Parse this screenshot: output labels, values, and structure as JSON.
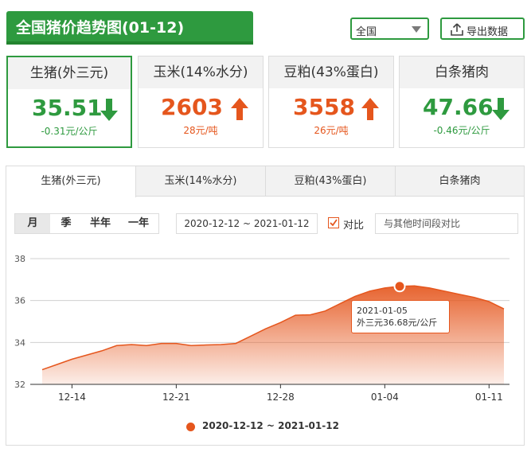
{
  "header": {
    "title": "全国猪价趋势图(01-12)",
    "region": "全国",
    "export_label": "导出数据"
  },
  "cards": [
    {
      "name": "生猪(外三元)",
      "price": "35.51",
      "change": "-0.31元/公斤",
      "trend": "down",
      "color": "#2e9a3f"
    },
    {
      "name": "玉米(14%水分)",
      "price": "2603",
      "change": "28元/吨",
      "trend": "up",
      "color": "#e5561d"
    },
    {
      "name": "豆粕(43%蛋白)",
      "price": "3558",
      "change": "26元/吨",
      "trend": "up",
      "color": "#e5561d"
    },
    {
      "name": "白条猪肉",
      "price": "47.66",
      "change": "-0.46元/公斤",
      "trend": "down",
      "color": "#2e9a3f"
    }
  ],
  "tabs": [
    "生猪(外三元)",
    "玉米(14%水分)",
    "豆粕(43%蛋白)",
    "白条猪肉"
  ],
  "controls": {
    "periods": [
      "月",
      "季",
      "半年",
      "一年"
    ],
    "date_range": "2020-12-12 ~ 2021-01-12",
    "compare_label": "对比",
    "compare_placeholder": "与其他时间段对比"
  },
  "tooltip": {
    "date": "2021-01-05",
    "value_text": "外三元36.68元/公斤"
  },
  "chart_data": {
    "type": "area",
    "x": [
      "2020-12-12",
      "2020-12-13",
      "2020-12-14",
      "2020-12-15",
      "2020-12-16",
      "2020-12-17",
      "2020-12-18",
      "2020-12-19",
      "2020-12-20",
      "2020-12-21",
      "2020-12-22",
      "2020-12-23",
      "2020-12-24",
      "2020-12-25",
      "2020-12-26",
      "2020-12-27",
      "2020-12-28",
      "2020-12-29",
      "2020-12-30",
      "2020-12-31",
      "2021-01-01",
      "2021-01-02",
      "2021-01-03",
      "2021-01-04",
      "2021-01-05",
      "2021-01-06",
      "2021-01-07",
      "2021-01-08",
      "2021-01-09",
      "2021-01-10",
      "2021-01-11",
      "2021-01-12"
    ],
    "series": [
      {
        "name": "2020-12-12 ~ 2021-01-12",
        "values": [
          32.7,
          32.95,
          33.2,
          33.4,
          33.6,
          33.85,
          33.9,
          33.85,
          33.95,
          33.95,
          33.85,
          33.88,
          33.9,
          33.95,
          34.3,
          34.65,
          34.95,
          35.3,
          35.32,
          35.5,
          35.85,
          36.2,
          36.45,
          36.6,
          36.68,
          36.7,
          36.6,
          36.45,
          36.3,
          36.15,
          35.95,
          35.6
        ]
      }
    ],
    "xticks": [
      "12-14",
      "12-21",
      "12-28",
      "01-04",
      "01-11"
    ],
    "xtick_dates": [
      "2020-12-14",
      "2020-12-21",
      "2020-12-28",
      "2021-01-04",
      "2021-01-11"
    ],
    "yticks": [
      32,
      34,
      36,
      38
    ],
    "ylim": [
      32,
      38
    ],
    "highlight_date": "2021-01-05",
    "grid": true,
    "legend_position": "bottom",
    "color": "#e5561d"
  }
}
